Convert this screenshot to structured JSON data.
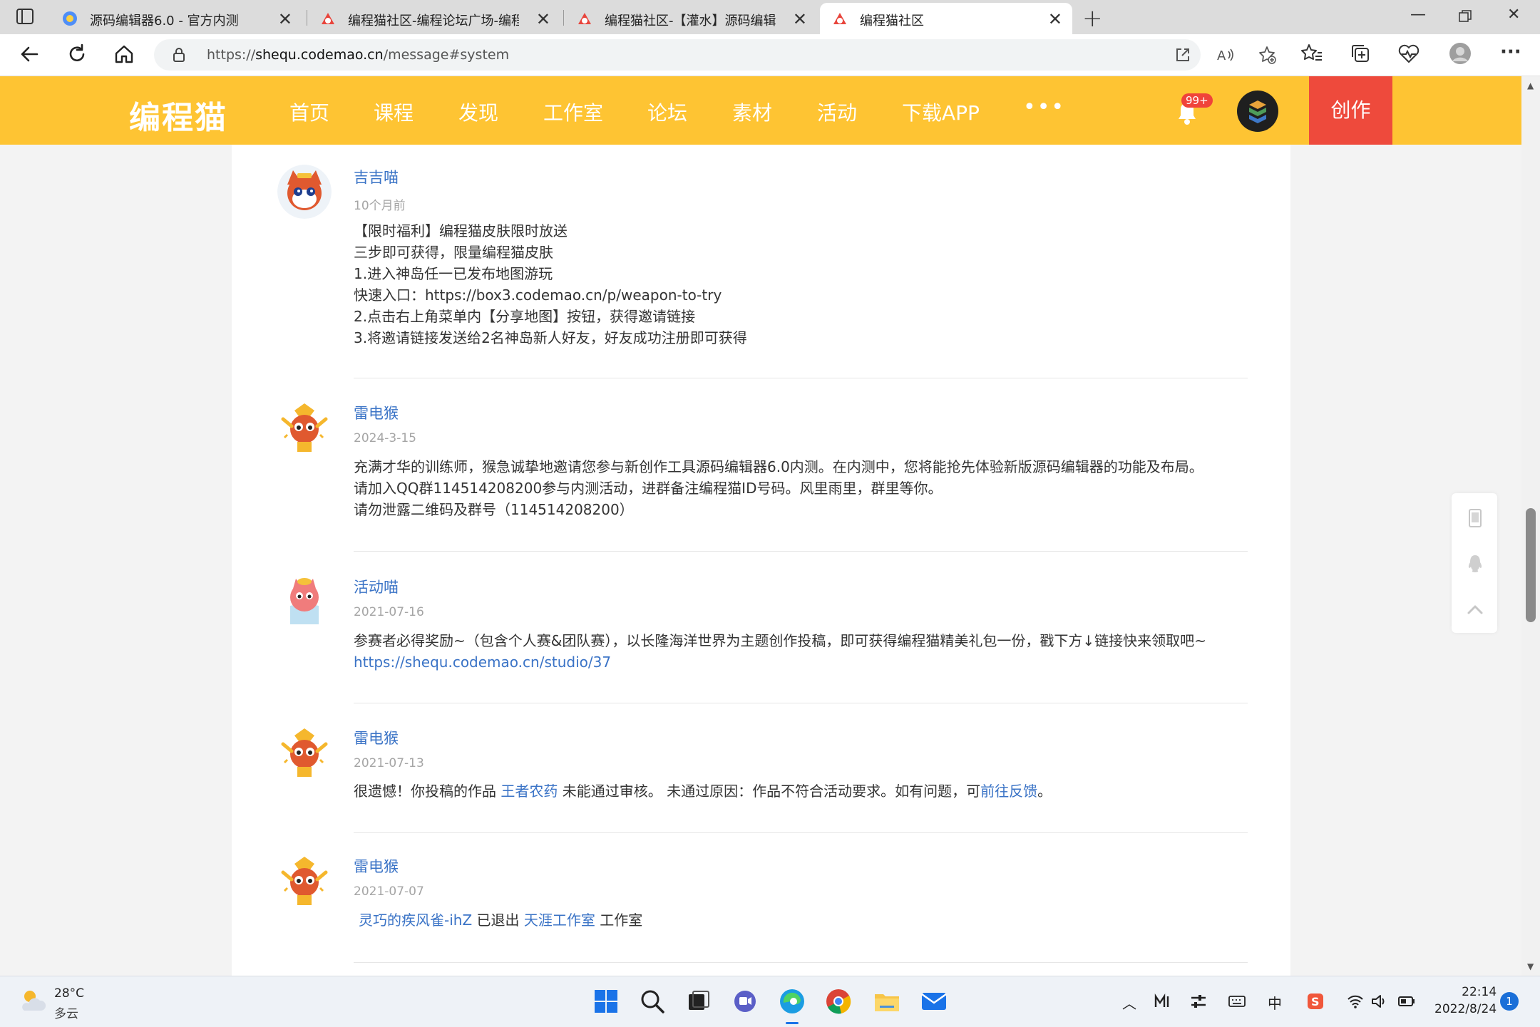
{
  "browser": {
    "tabs": [
      {
        "title": "源码编辑器6.0 - 官方内测",
        "active": false
      },
      {
        "title": "编程猫社区-编程论坛广场-编程学",
        "active": false
      },
      {
        "title": "编程猫社区-【灌水】源码编辑器",
        "active": false
      },
      {
        "title": "编程猫社区",
        "active": true
      }
    ],
    "url_prefix": "https://",
    "url_host": "shequ.codemao.cn",
    "url_path": "/message#system"
  },
  "site": {
    "logo": "编程猫",
    "nav": [
      "首页",
      "课程",
      "发现",
      "工作室",
      "论坛",
      "素材",
      "活动",
      "下载APP"
    ],
    "more": "•••",
    "notification_badge": "99+",
    "create_label": "创作",
    "brand_color": "#fec433"
  },
  "messages": [
    {
      "sender": "吉吉喵",
      "time": "10个月前",
      "lines": [
        "【限时福利】编程猫皮肤限时放送",
        "三步即可获得，限量编程猫皮肤",
        "1.进入神岛任一已发布地图游玩",
        "快速入口：https://box3.codemao.cn/p/weapon-to-try",
        "2.点击右上角菜单内【分享地图】按钮，获得邀请链接",
        "3.将邀请链接发送给2名神岛新人好友，好友成功注册即可获得"
      ]
    },
    {
      "sender": "雷电猴",
      "time": "2024-3-15",
      "lines": [
        "充满才华的训练师，猴急诚挚地邀请您参与新创作工具源码编辑器6.0内测。在内测中，您将能抢先体验新版源码编辑器的功能及布局。",
        "请加入QQ群114514208200参与内测活动，进群备注编程猫ID号码。风里雨里，群里等你。",
        "请勿泄露二维码及群号（114514208200）"
      ]
    },
    {
      "sender": "活动喵",
      "time": "2021-07-16",
      "line1": "参赛者必得奖励~（包含个人赛&团队赛），以长隆海洋世界为主题创作投稿，即可获得编程猫精美礼包一份，戳下方↓链接快来领取吧~",
      "link": "https://shequ.codemao.cn/studio/37"
    },
    {
      "sender": "雷电猴",
      "time": "2021-07-13",
      "pre": "很遗憾！你投稿的作品 ",
      "work": "王者农药",
      "mid": " 未能通过审核。 未通过原因：作品不符合活动要求。如有问题，可",
      "feedback": "前往反馈",
      "post": "。"
    },
    {
      "sender": "雷电猴",
      "time": "2021-07-07",
      "user": "灵巧的疾风雀-ihZ",
      "mid": " 已退出 ",
      "studio": "天涯工作室",
      "post": " 工作室"
    }
  ],
  "taskbar": {
    "temperature": "28°C",
    "condition": "多云",
    "time": "22:14",
    "date": "2022/8/24",
    "notifications": "1",
    "ime": "中"
  }
}
